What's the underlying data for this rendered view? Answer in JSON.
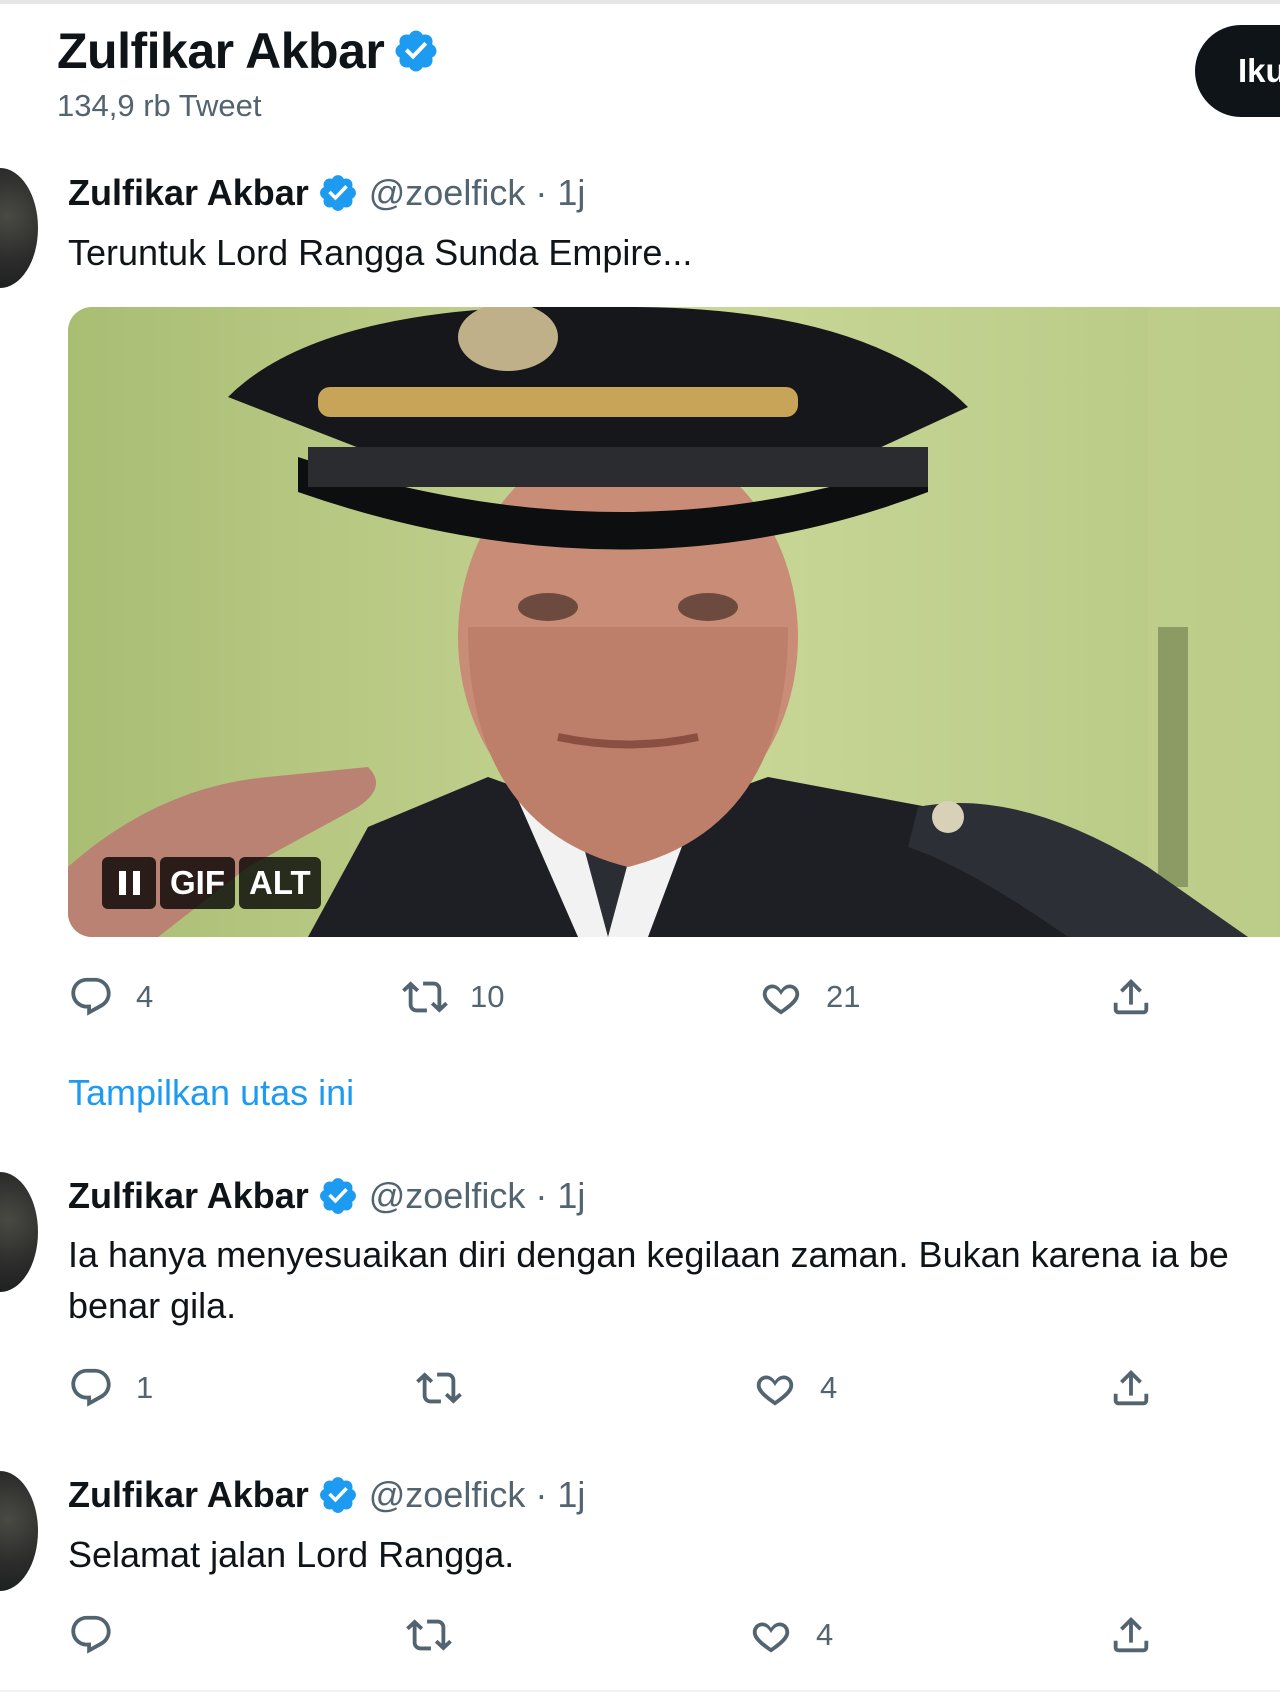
{
  "colors": {
    "verified_badge": "#1d9bf0",
    "link": "#1d9bf0",
    "secondary_text": "#536471",
    "follow_button_bg": "#0f1419"
  },
  "header": {
    "name": "Zulfikar Akbar",
    "tweet_count": "134,9 rb Tweet",
    "follow_label": "Iku"
  },
  "tweets": [
    {
      "author": "Zulfikar Akbar",
      "handle": "@zoelfick",
      "separator": "·",
      "time": "1j",
      "text": "Teruntuk Lord Rangga Sunda Empire...",
      "media": {
        "type": "gif",
        "controls": {
          "gif_label": "GIF",
          "alt_label": "ALT"
        }
      },
      "actions": {
        "replies": "4",
        "retweets": "10",
        "likes": "21"
      }
    },
    {
      "author": "Zulfikar Akbar",
      "handle": "@zoelfick",
      "separator": "·",
      "time": "1j",
      "text_line1": "Ia hanya menyesuaikan diri dengan kegilaan zaman. Bukan karena ia be",
      "text_line2": "benar gila.",
      "actions": {
        "replies": "1",
        "retweets": "",
        "likes": "4"
      }
    },
    {
      "author": "Zulfikar Akbar",
      "handle": "@zoelfick",
      "separator": "·",
      "time": "1j",
      "text": "Selamat jalan Lord Rangga.",
      "actions": {
        "replies": "",
        "retweets": "",
        "likes": "4"
      }
    }
  ],
  "show_thread_label": "Tampilkan utas ini",
  "icons": {
    "verified": "verified-badge-icon",
    "reply": "reply-icon",
    "retweet": "retweet-icon",
    "like": "heart-icon",
    "share": "share-icon",
    "pause": "pause-icon"
  }
}
